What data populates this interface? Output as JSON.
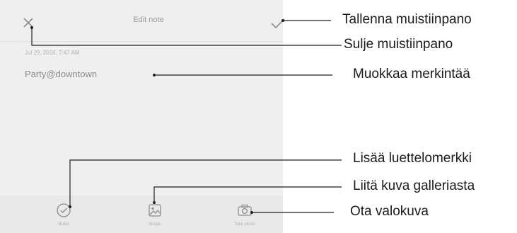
{
  "screen": {
    "title": "Edit note",
    "date": "Jul 29, 2016, 7:47 AM",
    "note_text": "Party@downtown",
    "toolbar": [
      {
        "label": "Bullet",
        "icon": "bullet-check-icon"
      },
      {
        "label": "Image",
        "icon": "image-icon"
      },
      {
        "label": "Take photo",
        "icon": "camera-icon"
      }
    ]
  },
  "callouts": {
    "save": "Tallenna muistiinpano",
    "close": "Sulje muistiinpano",
    "edit": "Muokkaa merkintää",
    "bullet": "Lisää luettelomerkki",
    "image": "Liitä kuva galleriasta",
    "photo": "Ota valokuva"
  }
}
